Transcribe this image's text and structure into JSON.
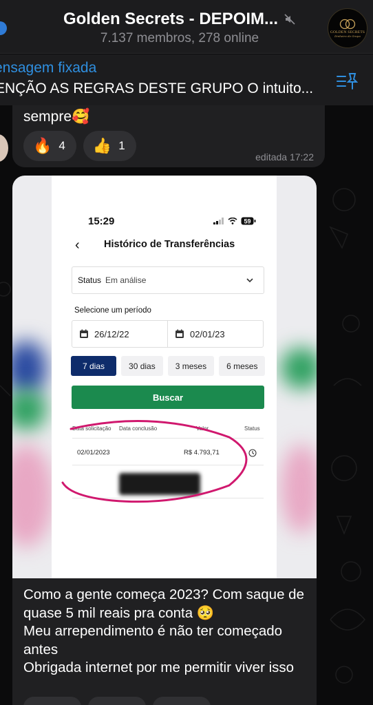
{
  "header": {
    "title": "Golden Secrets - DEPOIM...",
    "subtitle": "7.137 membros, 278 online",
    "avatar_text": "GOLDEN SECRETS",
    "avatar_sub": "Dinheiro de Grupo"
  },
  "pinned": {
    "label": "ensagem fixada",
    "text": "ENÇÃO AS REGRAS DESTE GRUPO O intuito..."
  },
  "message_top": {
    "text": "sempre🥰",
    "reactions": [
      {
        "emoji": "🔥",
        "count": "4"
      },
      {
        "emoji": "👍",
        "count": "1"
      }
    ],
    "edited": "editada 17:22"
  },
  "screenshot": {
    "time": "15:29",
    "battery": "59",
    "nav_back": "‹",
    "title": "Histórico de Transferências",
    "status_label": "Status",
    "status_value": "Em análise",
    "period_label": "Selecione um período",
    "date_from": "26/12/22",
    "date_to": "02/01/23",
    "chips": [
      "7 dias",
      "30 dias",
      "3 meses",
      "6 meses"
    ],
    "search_button": "Buscar",
    "columns": [
      "Data solicitação",
      "Data conclusão",
      "Valor",
      "Status"
    ],
    "row": {
      "date_request": "02/01/2023",
      "date_done": "",
      "value": "R$ 4.793,71"
    }
  },
  "caption": {
    "lines": [
      "Como a gente começa 2023? Com saque de quase 5 mil reais pra conta 🥺",
      "Meu arrependimento é não ter começado antes",
      "Obrigada internet por me permitir viver isso"
    ]
  },
  "colors": {
    "accent_blue": "#2f8fe0",
    "bubble": "#202022",
    "header": "#1c1c1e",
    "marker": "#d0186e",
    "buscar_green": "#1b8a4e",
    "chip_active": "#0e2c6b"
  }
}
